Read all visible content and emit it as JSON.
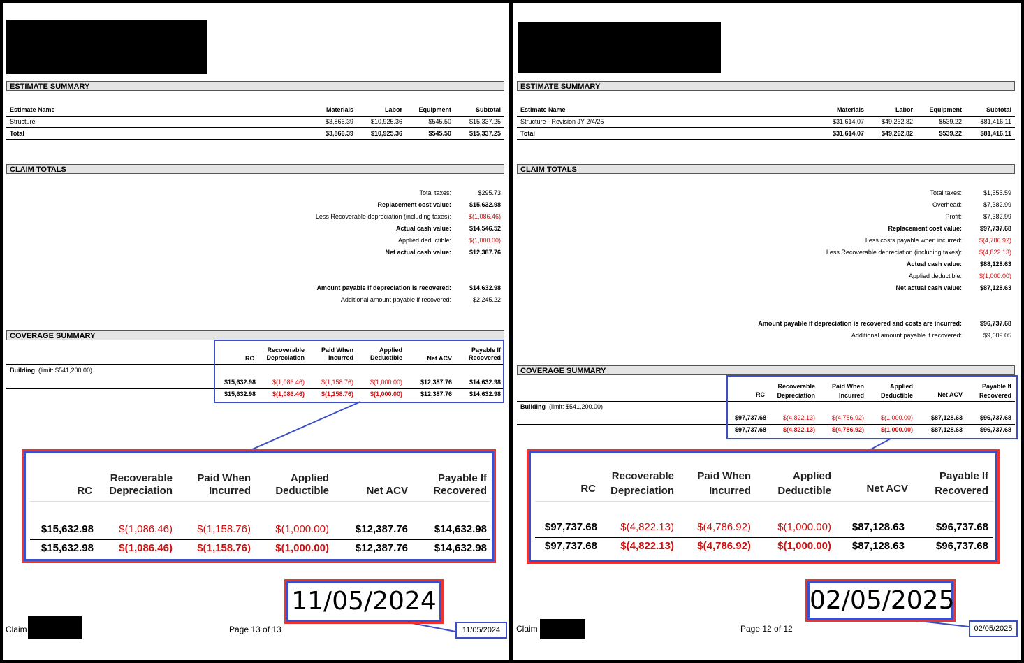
{
  "left": {
    "estimate_summary": {
      "title": "ESTIMATE SUMMARY",
      "headers": [
        "Estimate Name",
        "Materials",
        "Labor",
        "Equipment",
        "Subtotal"
      ],
      "row": [
        "Structure",
        "$3,866.39",
        "$10,925.36",
        "$545.50",
        "$15,337.25"
      ],
      "total": [
        "Total",
        "$3,866.39",
        "$10,925.36",
        "$545.50",
        "$15,337.25"
      ]
    },
    "claim_totals": {
      "title": "CLAIM TOTALS",
      "lines": [
        {
          "label": "Total taxes:",
          "value": "$295.73"
        },
        {
          "label": "Replacement cost value:",
          "value": "$15,632.98"
        },
        {
          "label": "Less Recoverable depreciation (including taxes):",
          "value": "$(1,086.46)"
        },
        {
          "label": "Actual cash value:",
          "value": "$14,546.52"
        },
        {
          "label": "Applied deductible:",
          "value": "$(1,000.00)"
        },
        {
          "label": "Net actual cash value:",
          "value": "$12,387.76"
        }
      ],
      "payable": {
        "label": "Amount payable if depreciation is recovered:",
        "value": "$14,632.98"
      },
      "additional": {
        "label": "Additional amount payable if recovered:",
        "value": "$2,245.22"
      }
    },
    "coverage_summary": {
      "title": "COVERAGE SUMMARY",
      "headers": [
        "RC",
        "Recoverable Depreciation",
        "Paid When Incurred",
        "Applied Deductible",
        "Net ACV",
        "Payable If Recovered"
      ],
      "building_label": "Building",
      "building_limit": "(limit: $541,200.00)",
      "row": [
        "$15,632.98",
        "$(1,086.46)",
        "$(1,158.76)",
        "$(1,000.00)",
        "$12,387.76",
        "$14,632.98"
      ],
      "total": [
        "$15,632.98",
        "$(1,086.46)",
        "$(1,158.76)",
        "$(1,000.00)",
        "$12,387.76",
        "$14,632.98"
      ]
    },
    "zoom_date": "11/05/2024",
    "footer": {
      "claim": "Claim",
      "page": "Page 13 of 13",
      "date": "11/05/2024"
    }
  },
  "right": {
    "estimate_summary": {
      "title": "ESTIMATE SUMMARY",
      "headers": [
        "Estimate Name",
        "Materials",
        "Labor",
        "Equipment",
        "Subtotal"
      ],
      "row": [
        "Structure - Revision JY 2/4/25",
        "$31,614.07",
        "$49,262.82",
        "$539.22",
        "$81,416.11"
      ],
      "total": [
        "Total",
        "$31,614.07",
        "$49,262.82",
        "$539.22",
        "$81,416.11"
      ]
    },
    "claim_totals": {
      "title": "CLAIM TOTALS",
      "lines": [
        {
          "label": "Total taxes:",
          "value": "$1,555.59"
        },
        {
          "label": "Overhead:",
          "value": "$7,382.99"
        },
        {
          "label": "Profit:",
          "value": "$7,382.99"
        },
        {
          "label": "Replacement cost value:",
          "value": "$97,737.68"
        },
        {
          "label": "Less costs payable when incurred:",
          "value": "$(4,786.92)"
        },
        {
          "label": "Less Recoverable depreciation (including taxes):",
          "value": "$(4,822.13)"
        },
        {
          "label": "Actual cash value:",
          "value": "$88,128.63"
        },
        {
          "label": "Applied deductible:",
          "value": "$(1,000.00)"
        },
        {
          "label": "Net actual cash value:",
          "value": "$87,128.63"
        }
      ],
      "payable": {
        "label": "Amount payable if depreciation is recovered and costs are incurred:",
        "value": "$96,737.68"
      },
      "additional": {
        "label": "Additional amount payable if recovered:",
        "value": "$9,609.05"
      }
    },
    "coverage_summary": {
      "title": "COVERAGE SUMMARY",
      "headers": [
        "RC",
        "Recoverable Depreciation",
        "Paid When Incurred",
        "Applied Deductible",
        "Net ACV",
        "Payable If Recovered"
      ],
      "building_label": "Building",
      "building_limit": "(limit: $541,200.00)",
      "row": [
        "$97,737.68",
        "$(4,822.13)",
        "$(4,786.92)",
        "$(1,000.00)",
        "$87,128.63",
        "$96,737.68"
      ],
      "total": [
        "$97,737.68",
        "$(4,822.13)",
        "$(4,786.92)",
        "$(1,000.00)",
        "$87,128.63",
        "$96,737.68"
      ]
    },
    "zoom_date": "02/05/2025",
    "footer": {
      "claim": "Claim",
      "page": "Page 12 of 12",
      "date": "02/05/2025"
    }
  },
  "colors": {
    "red": "#d01010",
    "blue_box": "#3b4fc8",
    "red_outline": "#e33333"
  }
}
